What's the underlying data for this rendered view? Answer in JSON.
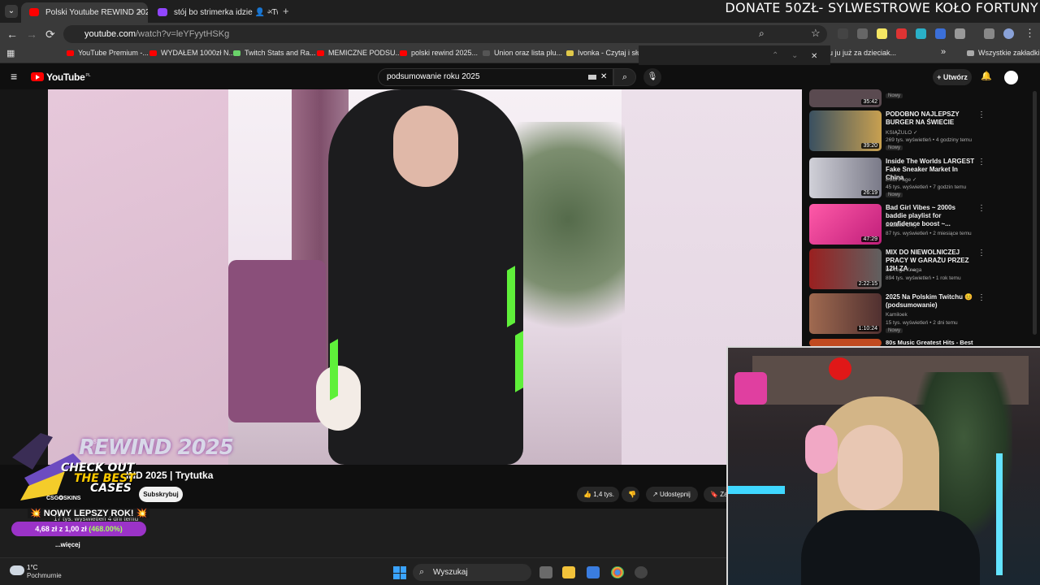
{
  "browser": {
    "tabs": [
      {
        "title": "Polski Youtube REWIND 2025 |",
        "active": true
      },
      {
        "title": "stój bo strimerka idzie 👤 - Tw",
        "active": false
      }
    ],
    "new_tab": "+",
    "tab_close": "×",
    "tab_menu": "⌄",
    "url_host": "youtube.com",
    "url_path": "/watch?v=leYFyytHSKg",
    "bookmarks": [
      "YouTube Premium -...",
      "WYDAŁEM 1000zł N...",
      "Twitch Stats and Ra...",
      "MEMICZNE PODSU...",
      "polski rewind 2025...",
      "Union oraz lista plu...",
      "Ivonka - Czytaj i słu...",
      "u ju już za dzieciak...",
      "Wszystkie zakładki"
    ],
    "bookmark_overflow": "»"
  },
  "stream_overlay": {
    "donate_text": "DONATE 50ZŁ- SYLWESTROWE KOŁO FORTUNY"
  },
  "youtube": {
    "logo": "YouTube",
    "logo_region": "PL",
    "search_value": "podsumowanie roku 2025",
    "create_label": "+ Utwórz",
    "video_title_partial": "IND 2025 | Trytutka",
    "subscribe_label": "Subskrybuj",
    "likes": "1,4 tys.",
    "share_label": "Udostępnij",
    "save_label": "Za",
    "views": "17 tys. wyświetleń  4 dni temu",
    "more_label": "...więcej",
    "recommendations": [
      {
        "title": "",
        "channel": "",
        "meta": "",
        "duration": "35:42",
        "badge": "Nowy",
        "thumb_color": "#5a4a50"
      },
      {
        "title": "PODOBNO NAJLEPSZY BURGER NA ŚWIECIE",
        "channel": "KSIĄŻULO ✓",
        "meta": "269 tys. wyświetleń • 4 godziny temu",
        "duration": "39:20",
        "badge": "Nowy",
        "thumb_color": "#7a6a4a"
      },
      {
        "title": "Inside The Worlds LARGEST Fake Sneaker Market In China",
        "channel": "Elliot Page ✓",
        "meta": "45 tys. wyświetleń • 7 godzin temu",
        "duration": "26:19",
        "badge": "Nowy",
        "thumb_color": "#6c6c78"
      },
      {
        "title": "Bad Girl Vibes ~ 2000s baddie playlist for confidence boost ~...",
        "channel": "Baddies Only",
        "meta": "87 tys. wyświetleń • 2 miesiące temu",
        "duration": "47:29",
        "badge": "",
        "thumb_color": "#e0469c"
      },
      {
        "title": "MIX DO NIEWOLNICZEJ PRACY W GARAŻU PRZEZ 12H ZA ...",
        "channel": "DJ Tega Knaga",
        "meta": "894 tys. wyświetleń • 1 rok temu",
        "duration": "2:22:15",
        "badge": "",
        "thumb_color": "#7a3030"
      },
      {
        "title": "2025 Na Polskim Twitchu 😊 (podsumowanie)",
        "channel": "Kamiloek",
        "meta": "15 tys. wyświetleń • 2 dni temu",
        "duration": "1:10:24",
        "badge": "Nowy",
        "thumb_color": "#8a5a40"
      },
      {
        "title": "80s Music Greatest Hits - Best",
        "channel": "",
        "meta": "",
        "duration": "",
        "badge": "",
        "thumb_color": "#c04a20"
      }
    ]
  },
  "promo": {
    "polski_label": "POLSKI",
    "rewind_label": "REWIND 2025",
    "check_line1": "CHECK OUT",
    "check_line2": "THE BEST",
    "check_line3": "CASES",
    "brand": "CSG✪SKINS",
    "new_year": "💥 NOWY LEPSZY ROK! 💥",
    "price_prefix": "4,68 zł z 1,00 zł ",
    "price_pct": "(468.00%)"
  },
  "taskbar": {
    "temperature": "1°C",
    "condition": "Pochmurnie",
    "search_placeholder": "Wyszukaj"
  },
  "icons": {
    "back": "←",
    "forward": "→",
    "reload": "⟳",
    "star": "☆",
    "menu": "⋮",
    "hamburger": "≡",
    "search": "⌕",
    "mic": "🎙",
    "bell": "🔔",
    "close": "✕",
    "like": "👍",
    "dislike": "👎",
    "share": "↗",
    "save": "🔖",
    "kebab": "⋮",
    "apps": "▦",
    "up": "⌃",
    "down": "⌄"
  },
  "colors": {
    "accent_red": "#ff0000",
    "promo_purple": "#9b33c8",
    "promo_green": "#a3ff5c"
  }
}
